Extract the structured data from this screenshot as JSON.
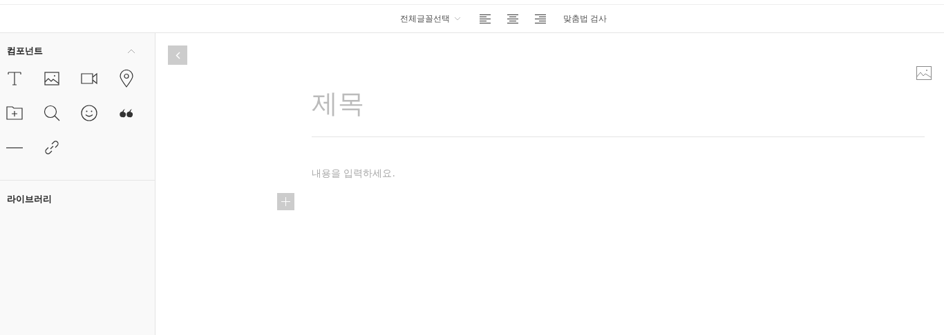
{
  "toolbar": {
    "font_select": {
      "label": "전체글꼴선택"
    },
    "align_buttons": [
      {
        "kind": "left"
      },
      {
        "kind": "center"
      },
      {
        "kind": "right"
      }
    ],
    "spellcheck": {
      "label": "맞춤법 검사"
    }
  },
  "sidebar": {
    "components": {
      "title": "컴포넌트",
      "expanded": true,
      "items": [
        {
          "kind": "text"
        },
        {
          "kind": "image"
        },
        {
          "kind": "video"
        },
        {
          "kind": "place"
        },
        {
          "kind": "folder"
        },
        {
          "kind": "search"
        },
        {
          "kind": "emoticon"
        },
        {
          "kind": "quote"
        },
        {
          "kind": "divider"
        },
        {
          "kind": "link"
        }
      ]
    },
    "library": {
      "title": "라이브러리"
    }
  },
  "editor": {
    "title": {
      "placeholder": "제목"
    },
    "body": {
      "placeholder": "내용을 입력하세요."
    }
  }
}
